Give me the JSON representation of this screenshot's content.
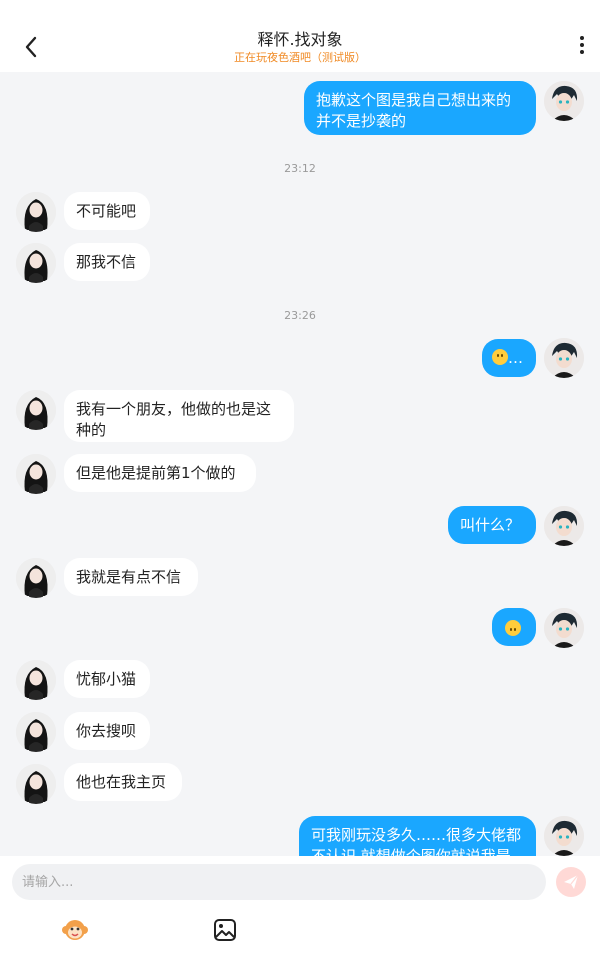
{
  "header": {
    "title": "释怀.找对象",
    "subtitle": "正在玩夜色酒吧（测试版）"
  },
  "messages": [
    {
      "side": "out",
      "text": "抱歉这个图是我自己想出来的\n并不是抄袭的"
    },
    {
      "side": "ts",
      "text": "23:12"
    },
    {
      "side": "in",
      "text": "不可能吧"
    },
    {
      "side": "in",
      "text": "那我不信"
    },
    {
      "side": "ts",
      "text": "23:26"
    },
    {
      "side": "out",
      "text": "…",
      "emoji": "neutral-face-emoji"
    },
    {
      "side": "in",
      "text": "我有一个朋友，他做的也是这\n种的"
    },
    {
      "side": "in",
      "text": "但是他是提前第1个做的"
    },
    {
      "side": "out",
      "text": "叫什么？"
    },
    {
      "side": "in",
      "text": "我就是有点不信"
    },
    {
      "side": "out",
      "text": "",
      "emoji": "upside-down-face-emoji"
    },
    {
      "side": "in",
      "text": "忧郁小猫"
    },
    {
      "side": "in",
      "text": "你去搜呗"
    },
    {
      "side": "in",
      "text": "他也在我主页"
    },
    {
      "side": "out",
      "text": "可我刚玩没多久……很多大佬都\n不认识 就想做个图你就说我是"
    }
  ],
  "input": {
    "placeholder": "请输入..."
  },
  "icons": {
    "back": "chevron-left-icon",
    "more": "vertical-dots-icon",
    "send": "paper-plane-icon",
    "sticker": "monkey-face-icon",
    "image": "image-icon"
  },
  "colors": {
    "out_bubble": "#1aa7ff",
    "in_bubble": "#ffffff",
    "subtitle": "#f08a24",
    "send_button": "#ffd9d6"
  }
}
